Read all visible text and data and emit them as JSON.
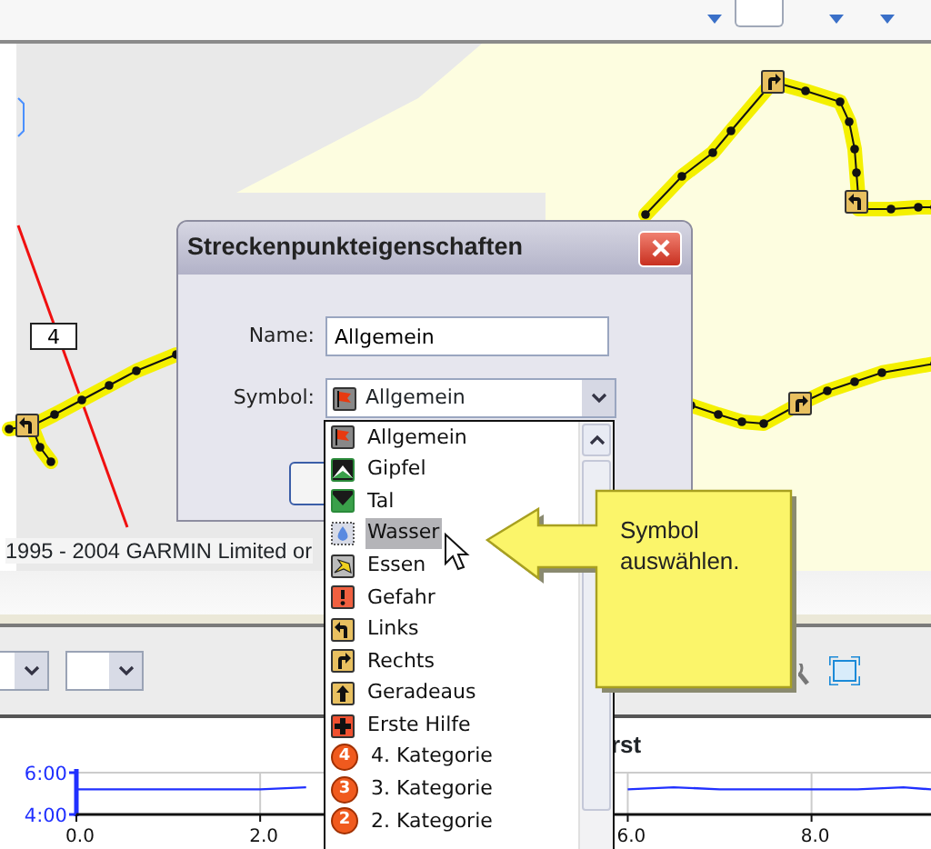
{
  "map": {
    "road_label": "4",
    "copyright": "1995 - 2004 GARMIN Limited or"
  },
  "dialog": {
    "title": "Streckenpunkteigenschaften",
    "name_field": {
      "label": "Name:",
      "value": "Allgemein"
    },
    "symbol_field": {
      "label": "Symbol:",
      "value": "Allgemein",
      "kind": "flag"
    }
  },
  "symbol_list": {
    "items": [
      {
        "kind": "flag",
        "label": "Allgemein",
        "selected": false
      },
      {
        "kind": "summit",
        "label": "Gipfel",
        "selected": false
      },
      {
        "kind": "valley",
        "label": "Tal",
        "selected": false
      },
      {
        "kind": "water",
        "label": "Wasser",
        "selected": true
      },
      {
        "kind": "food",
        "label": "Essen",
        "selected": false
      },
      {
        "kind": "danger",
        "label": "Gefahr",
        "selected": false
      },
      {
        "kind": "left",
        "label": "Links",
        "selected": false
      },
      {
        "kind": "right",
        "label": "Rechts",
        "selected": false
      },
      {
        "kind": "straight",
        "label": "Geradeaus",
        "selected": false
      },
      {
        "kind": "first_aid",
        "label": "Erste Hilfe",
        "selected": false
      },
      {
        "kind": "category",
        "badge": "4",
        "label": "4. Kategorie",
        "selected": false
      },
      {
        "kind": "category",
        "badge": "3",
        "label": "3. Kategorie",
        "selected": false
      },
      {
        "kind": "category",
        "badge": "2",
        "label": "2. Kategorie",
        "selected": false
      }
    ]
  },
  "callout": {
    "text": "Symbol auswählen."
  },
  "chart": {
    "chart_data": {
      "type": "line",
      "title": "rst",
      "grid": true,
      "x": [
        0,
        0.5,
        1,
        1.5,
        2,
        2.5,
        3,
        3.5,
        4,
        4.5,
        5,
        5.5,
        6,
        6.5,
        7,
        7.5,
        8,
        8.5,
        9,
        9.3
      ],
      "series": [
        {
          "color": "#2030ff",
          "values": [
            5.2,
            5.2,
            5.2,
            5.2,
            5.2,
            5.3,
            null,
            null,
            null,
            null,
            null,
            null,
            5.2,
            5.3,
            5.2,
            5.2,
            5.2,
            5.2,
            5.3,
            5.2
          ]
        }
      ],
      "xlim": [
        0,
        9.3
      ],
      "ylim": [
        4,
        6
      ],
      "xticks": [
        {
          "value": 0,
          "label": "0.0"
        },
        {
          "value": 2,
          "label": "2.0"
        },
        {
          "value": 6,
          "label": "6.0"
        },
        {
          "value": 8,
          "label": "8.0"
        }
      ],
      "yticks": [
        {
          "value": 4,
          "label": "4:00"
        },
        {
          "value": 6,
          "label": "6:00"
        }
      ]
    }
  }
}
